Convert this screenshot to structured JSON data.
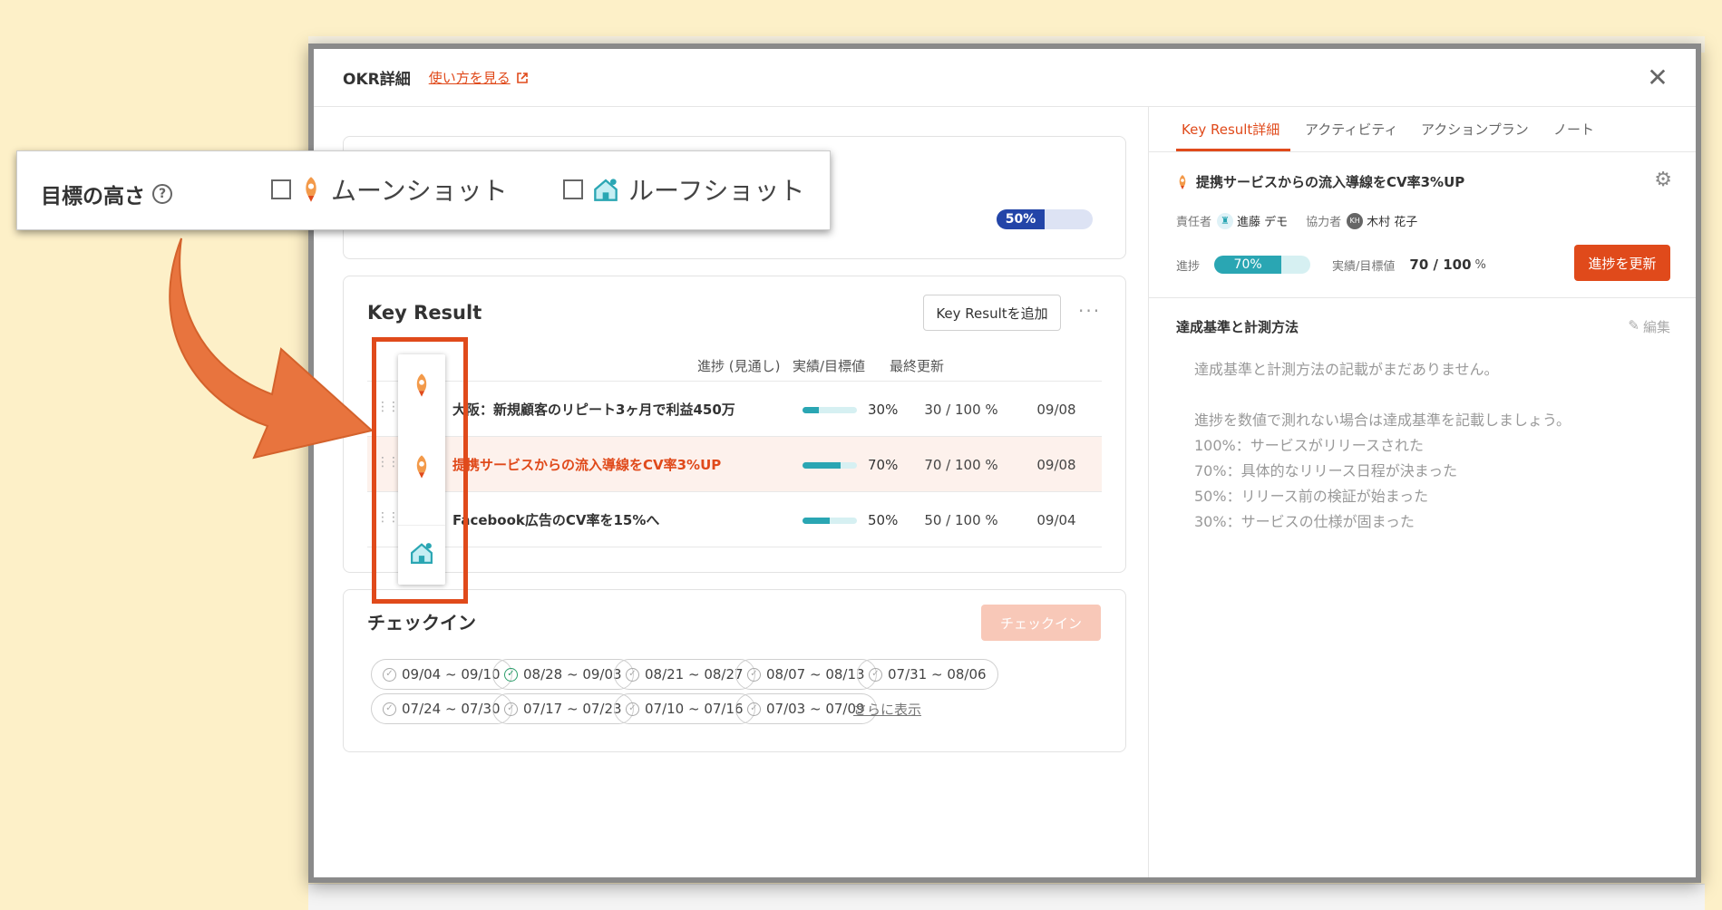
{
  "modal": {
    "title": "OKR詳細",
    "howto_link": "使い方を見る",
    "close_icon": "close-icon"
  },
  "objective": {
    "progress_label": "50%",
    "progress": 0.5
  },
  "key_result": {
    "title": "Key Result",
    "add_button": "Key Resultを追加",
    "more_icon": "ellipsis-icon",
    "columns": {
      "progress": "進捗 (見通し)",
      "actual_target": "実績/目標値",
      "last_update": "最終更新"
    },
    "rows": [
      {
        "name": "大阪：新規顧客のリピート3ヶ月で利益450万",
        "progress": 0.3,
        "pct": "30%",
        "value": "30 / 100 %",
        "date": "09/08",
        "active": false
      },
      {
        "name": "提携サービスからの流入導線をCV率3%UP",
        "progress": 0.7,
        "pct": "70%",
        "value": "70 / 100 %",
        "date": "09/08",
        "active": true
      },
      {
        "name": "Facebook広告のCV率を15%へ",
        "progress": 0.5,
        "pct": "50%",
        "value": "50 / 100 %",
        "date": "09/04",
        "active": false
      }
    ]
  },
  "checkin": {
    "title": "チェックイン",
    "button": "チェックイン",
    "periods": [
      {
        "label": "09/04 ~ 09/10",
        "done": false
      },
      {
        "label": "08/28 ~ 09/03",
        "done": true
      },
      {
        "label": "08/21 ~ 08/27",
        "done": false
      },
      {
        "label": "08/07 ~ 08/13",
        "done": false
      },
      {
        "label": "07/31 ~ 08/06",
        "done": false
      },
      {
        "label": "07/24 ~ 07/30",
        "done": false
      },
      {
        "label": "07/17 ~ 07/23",
        "done": false
      },
      {
        "label": "07/10 ~ 07/16",
        "done": false
      },
      {
        "label": "07/03 ~ 07/09",
        "done": false
      }
    ],
    "more": "さらに表示"
  },
  "right": {
    "tabs": [
      "Key Result詳細",
      "アクティビティ",
      "アクションプラン",
      "ノート"
    ],
    "kr_title": "提携サービスからの流入導線をCV率3%UP",
    "owner_label": "責任者",
    "owner_name": "進藤 デモ",
    "collab_label": "協力者",
    "collab_name": "木村 花子",
    "collab_avatar": "KH",
    "progress_label": "進捗",
    "progress_pct": "70%",
    "progress": 0.7,
    "actual_label": "実績/目標値",
    "actual_value": "70 / 100",
    "actual_unit": "%",
    "update_button": "進捗を更新",
    "criteria_title": "達成基準と計測方法",
    "edit_label": "編集",
    "criteria_lines": [
      "達成基準と計測方法の記載がまだありません。",
      "",
      "進捗を数値で測れない場合は達成基準を記載しましょう。",
      "100%：サービスがリリースされた",
      "70%：具体的なリリース日程が決まった",
      "50%：リリース前の検証が始まった",
      "30%：サービスの仕様が固まった"
    ]
  },
  "callout": {
    "label": "目標の高さ",
    "option_moon": "ムーンショット",
    "option_roof": "ルーフショット"
  },
  "colors": {
    "accent": "#e04a1b",
    "teal": "#2aa6b3",
    "navy": "#2345a8",
    "background": "#fdf0c8",
    "arrow": "#e8743e"
  }
}
